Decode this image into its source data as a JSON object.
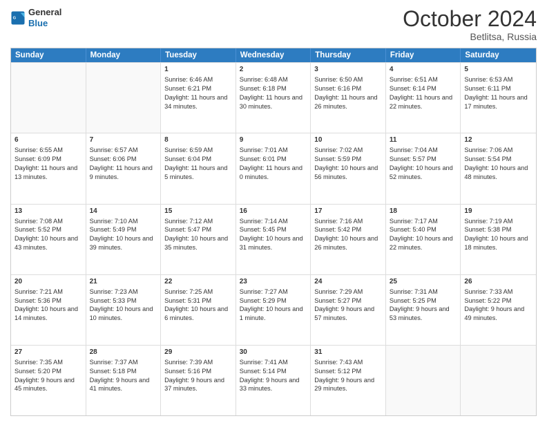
{
  "logo": {
    "line1": "General",
    "line2": "Blue"
  },
  "title": "October 2024",
  "location": "Betlitsa, Russia",
  "days_of_week": [
    "Sunday",
    "Monday",
    "Tuesday",
    "Wednesday",
    "Thursday",
    "Friday",
    "Saturday"
  ],
  "weeks": [
    [
      {
        "day": "",
        "content": ""
      },
      {
        "day": "",
        "content": ""
      },
      {
        "day": "1",
        "content": "Sunrise: 6:46 AM\nSunset: 6:21 PM\nDaylight: 11 hours and 34 minutes."
      },
      {
        "day": "2",
        "content": "Sunrise: 6:48 AM\nSunset: 6:18 PM\nDaylight: 11 hours and 30 minutes."
      },
      {
        "day": "3",
        "content": "Sunrise: 6:50 AM\nSunset: 6:16 PM\nDaylight: 11 hours and 26 minutes."
      },
      {
        "day": "4",
        "content": "Sunrise: 6:51 AM\nSunset: 6:14 PM\nDaylight: 11 hours and 22 minutes."
      },
      {
        "day": "5",
        "content": "Sunrise: 6:53 AM\nSunset: 6:11 PM\nDaylight: 11 hours and 17 minutes."
      }
    ],
    [
      {
        "day": "6",
        "content": "Sunrise: 6:55 AM\nSunset: 6:09 PM\nDaylight: 11 hours and 13 minutes."
      },
      {
        "day": "7",
        "content": "Sunrise: 6:57 AM\nSunset: 6:06 PM\nDaylight: 11 hours and 9 minutes."
      },
      {
        "day": "8",
        "content": "Sunrise: 6:59 AM\nSunset: 6:04 PM\nDaylight: 11 hours and 5 minutes."
      },
      {
        "day": "9",
        "content": "Sunrise: 7:01 AM\nSunset: 6:01 PM\nDaylight: 11 hours and 0 minutes."
      },
      {
        "day": "10",
        "content": "Sunrise: 7:02 AM\nSunset: 5:59 PM\nDaylight: 10 hours and 56 minutes."
      },
      {
        "day": "11",
        "content": "Sunrise: 7:04 AM\nSunset: 5:57 PM\nDaylight: 10 hours and 52 minutes."
      },
      {
        "day": "12",
        "content": "Sunrise: 7:06 AM\nSunset: 5:54 PM\nDaylight: 10 hours and 48 minutes."
      }
    ],
    [
      {
        "day": "13",
        "content": "Sunrise: 7:08 AM\nSunset: 5:52 PM\nDaylight: 10 hours and 43 minutes."
      },
      {
        "day": "14",
        "content": "Sunrise: 7:10 AM\nSunset: 5:49 PM\nDaylight: 10 hours and 39 minutes."
      },
      {
        "day": "15",
        "content": "Sunrise: 7:12 AM\nSunset: 5:47 PM\nDaylight: 10 hours and 35 minutes."
      },
      {
        "day": "16",
        "content": "Sunrise: 7:14 AM\nSunset: 5:45 PM\nDaylight: 10 hours and 31 minutes."
      },
      {
        "day": "17",
        "content": "Sunrise: 7:16 AM\nSunset: 5:42 PM\nDaylight: 10 hours and 26 minutes."
      },
      {
        "day": "18",
        "content": "Sunrise: 7:17 AM\nSunset: 5:40 PM\nDaylight: 10 hours and 22 minutes."
      },
      {
        "day": "19",
        "content": "Sunrise: 7:19 AM\nSunset: 5:38 PM\nDaylight: 10 hours and 18 minutes."
      }
    ],
    [
      {
        "day": "20",
        "content": "Sunrise: 7:21 AM\nSunset: 5:36 PM\nDaylight: 10 hours and 14 minutes."
      },
      {
        "day": "21",
        "content": "Sunrise: 7:23 AM\nSunset: 5:33 PM\nDaylight: 10 hours and 10 minutes."
      },
      {
        "day": "22",
        "content": "Sunrise: 7:25 AM\nSunset: 5:31 PM\nDaylight: 10 hours and 6 minutes."
      },
      {
        "day": "23",
        "content": "Sunrise: 7:27 AM\nSunset: 5:29 PM\nDaylight: 10 hours and 1 minute."
      },
      {
        "day": "24",
        "content": "Sunrise: 7:29 AM\nSunset: 5:27 PM\nDaylight: 9 hours and 57 minutes."
      },
      {
        "day": "25",
        "content": "Sunrise: 7:31 AM\nSunset: 5:25 PM\nDaylight: 9 hours and 53 minutes."
      },
      {
        "day": "26",
        "content": "Sunrise: 7:33 AM\nSunset: 5:22 PM\nDaylight: 9 hours and 49 minutes."
      }
    ],
    [
      {
        "day": "27",
        "content": "Sunrise: 7:35 AM\nSunset: 5:20 PM\nDaylight: 9 hours and 45 minutes."
      },
      {
        "day": "28",
        "content": "Sunrise: 7:37 AM\nSunset: 5:18 PM\nDaylight: 9 hours and 41 minutes."
      },
      {
        "day": "29",
        "content": "Sunrise: 7:39 AM\nSunset: 5:16 PM\nDaylight: 9 hours and 37 minutes."
      },
      {
        "day": "30",
        "content": "Sunrise: 7:41 AM\nSunset: 5:14 PM\nDaylight: 9 hours and 33 minutes."
      },
      {
        "day": "31",
        "content": "Sunrise: 7:43 AM\nSunset: 5:12 PM\nDaylight: 9 hours and 29 minutes."
      },
      {
        "day": "",
        "content": ""
      },
      {
        "day": "",
        "content": ""
      }
    ]
  ]
}
